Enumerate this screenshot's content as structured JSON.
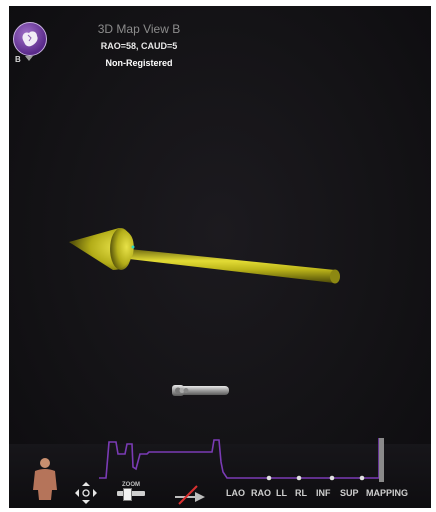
{
  "view": {
    "badge_letter": "B",
    "title": "3D Map View B",
    "angles": "RAO=58, CAUD=5",
    "registration": "Non-Registered"
  },
  "toolbar": {
    "zoom_label": "ZOOM",
    "view_buttons": [
      "LAO",
      "RAO",
      "LL",
      "RL",
      "INF",
      "SUP",
      "MAPPING"
    ]
  },
  "colors": {
    "background": "#141316",
    "arrow": "#c8c21a",
    "signal_trace": "#7a3bb5",
    "view_icon": "#6a3596"
  },
  "icons": {
    "view_icon": "heart-icon",
    "torso": "torso-orientation-icon",
    "navigation": "navigation-pad-icon",
    "catheter_toggle": "catheter-off-icon"
  }
}
